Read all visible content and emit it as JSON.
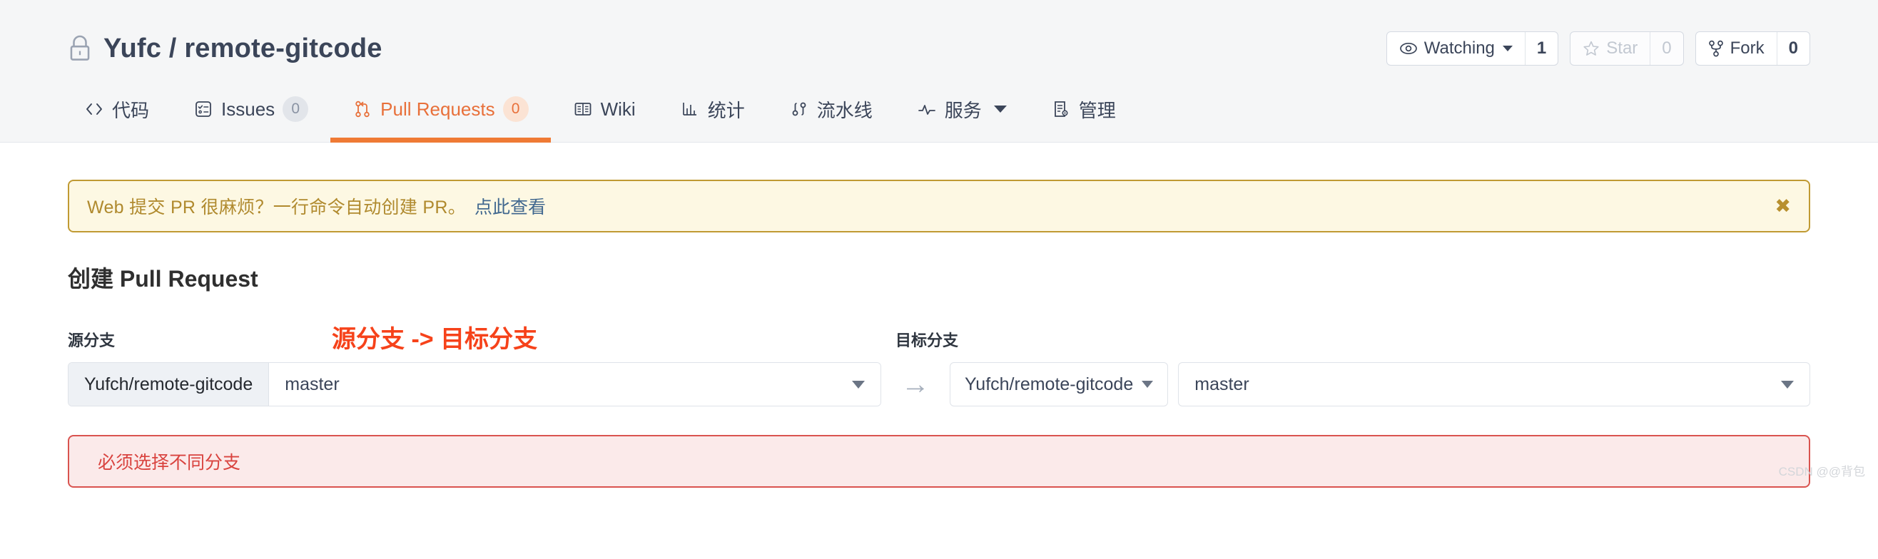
{
  "header": {
    "repo_title": "Yufc / remote-gitcode",
    "lock_icon": "lock-icon",
    "actions": [
      {
        "icon": "eye-icon",
        "label": "Watching",
        "count": "1",
        "has_caret": true,
        "disabled": false
      },
      {
        "icon": "star-icon",
        "label": "Star",
        "count": "0",
        "has_caret": false,
        "disabled": true
      },
      {
        "icon": "fork-icon",
        "label": "Fork",
        "count": "0",
        "has_caret": false,
        "disabled": false
      }
    ]
  },
  "nav": {
    "tabs": [
      {
        "label": "代码",
        "icon": "code-icon",
        "badge": null,
        "active": false,
        "caret": false
      },
      {
        "label": "Issues",
        "icon": "issues-icon",
        "badge": "0",
        "active": false,
        "caret": false
      },
      {
        "label": "Pull Requests",
        "icon": "pull-request-icon",
        "badge": "0",
        "active": true,
        "caret": false
      },
      {
        "label": "Wiki",
        "icon": "wiki-icon",
        "badge": null,
        "active": false,
        "caret": false
      },
      {
        "label": "统计",
        "icon": "chart-icon",
        "badge": null,
        "active": false,
        "caret": false
      },
      {
        "label": "流水线",
        "icon": "pipeline-icon",
        "badge": null,
        "active": false,
        "caret": false
      },
      {
        "label": "服务",
        "icon": "activity-icon",
        "badge": null,
        "active": false,
        "caret": true
      },
      {
        "label": "管理",
        "icon": "settings-doc-icon",
        "badge": null,
        "active": false,
        "caret": false
      }
    ]
  },
  "banner": {
    "text": "Web 提交 PR 很麻烦？一行命令自动创建 PR。",
    "link_label": "点此查看",
    "close_icon": "close-icon",
    "border_color": "#c09a33",
    "background_color": "#fdf8e3"
  },
  "main": {
    "page_title": "创建 Pull Request",
    "annotation": "源分支 -> 目标分支",
    "annotation_color": "#f6421a",
    "source": {
      "label": "源分支",
      "repo": "Yufch/remote-gitcode",
      "branch": "master"
    },
    "arrow_icon": "arrow-right-icon",
    "target": {
      "label": "目标分支",
      "repo": "Yufch/remote-gitcode",
      "branch": "master"
    },
    "error": {
      "message": "必须选择不同分支",
      "color": "#d9433f",
      "background_color": "#fbeaea"
    }
  },
  "watermark": "CSDN @@背包"
}
